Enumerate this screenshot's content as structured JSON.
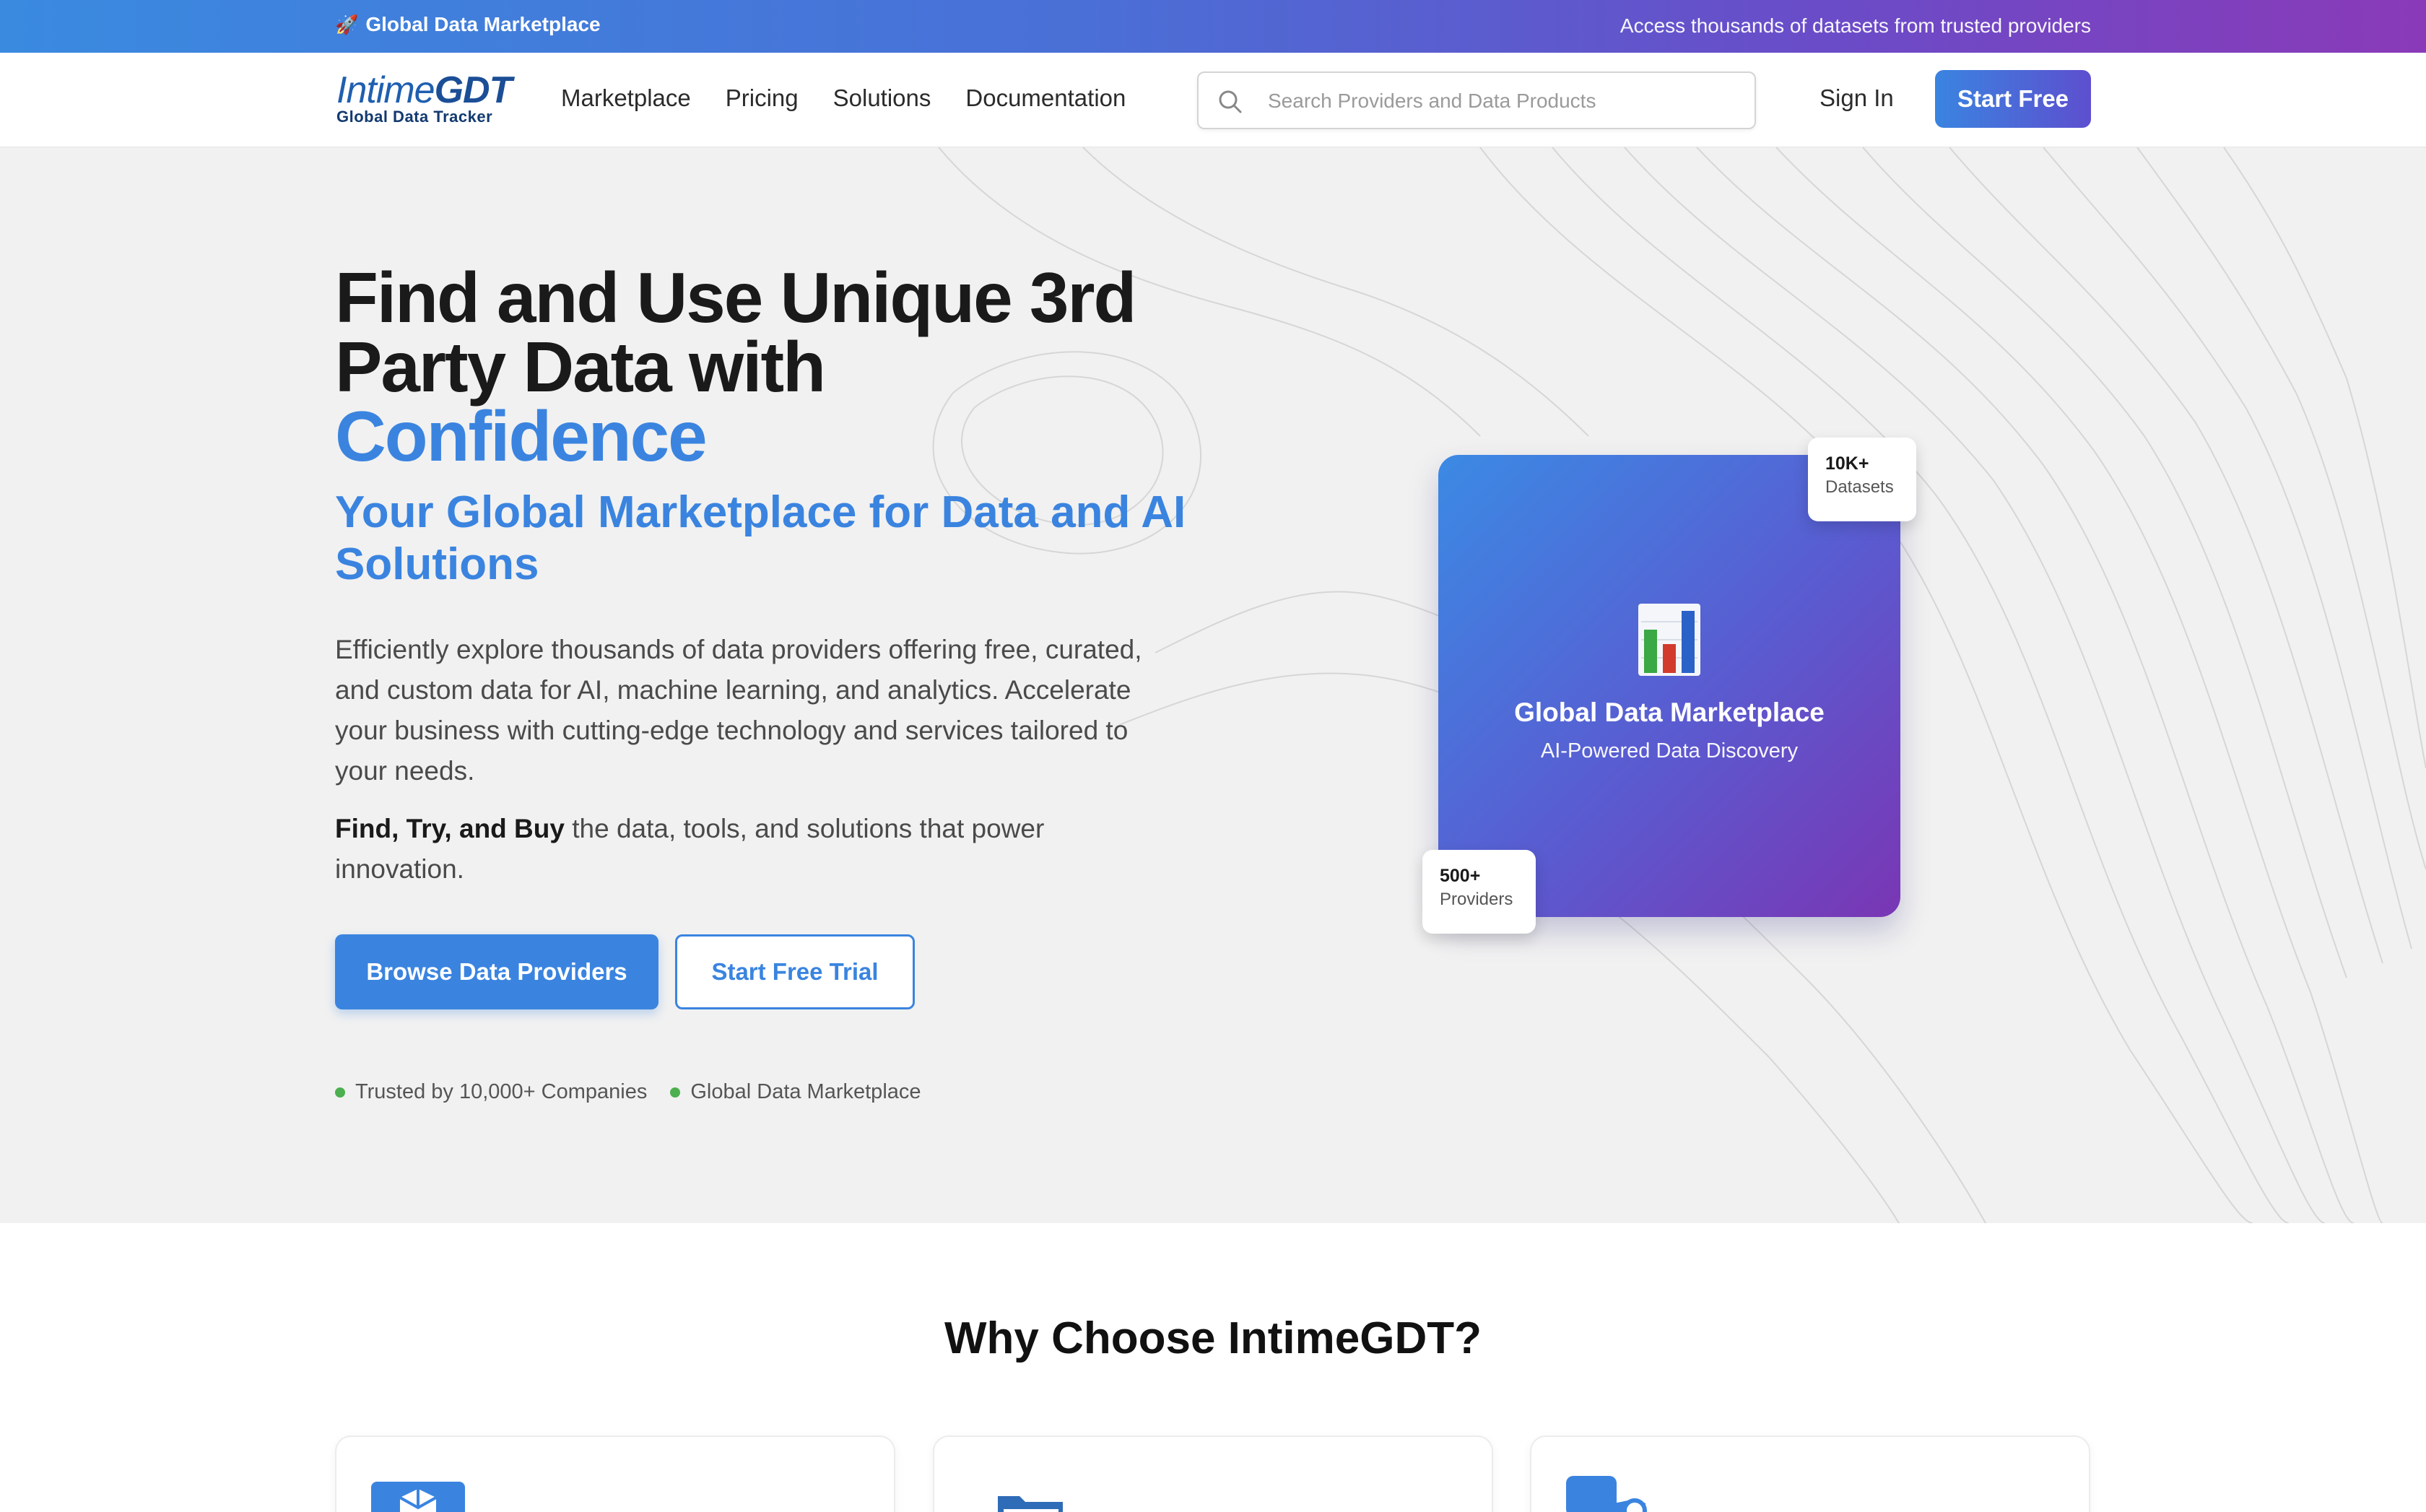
{
  "announcement": {
    "icon": "rocket-icon",
    "left_text": "Global Data Marketplace",
    "right_text": "Access thousands of datasets from trusted providers"
  },
  "header": {
    "logo_main": "Intime",
    "logo_accent": "GDT",
    "logo_tagline": "Global Data Tracker",
    "nav": [
      "Marketplace",
      "Pricing",
      "Solutions",
      "Documentation"
    ],
    "search_placeholder": "Search Providers and Data Products",
    "search_value": "",
    "sign_in": "Sign In",
    "start_free": "Start Free"
  },
  "hero": {
    "title_line1": "Find and Use Unique 3rd Party Data with",
    "title_accent": "Confidence",
    "subtitle": "Your Global Marketplace for Data and AI Solutions",
    "description": "Efficiently explore thousands of data providers offering free, curated, and custom data for AI, machine learning, and analytics. Accelerate your business with cutting-edge technology and services tailored to your needs.",
    "tagline_bold": "Find, Try, and Buy",
    "tagline_rest": " the data, tools, and solutions that power innovation.",
    "primary_button": "Browse Data Providers",
    "secondary_button": "Start Free Trial",
    "trust_items": [
      "Trusted by 10,000+ Companies",
      "Global Data Marketplace"
    ],
    "card": {
      "icon": "bar-chart-icon",
      "title": "Global Data Marketplace",
      "subtitle": "AI-Powered Data Discovery"
    },
    "stats": [
      {
        "value": "10K+",
        "label": "Datasets"
      },
      {
        "value": "500+",
        "label": "Providers"
      }
    ]
  },
  "why": {
    "heading": "Why Choose IntimeGDT?",
    "features": [
      {
        "icon": "cube-icon"
      },
      {
        "icon": "folders-icon"
      },
      {
        "icon": "connect-icon"
      }
    ]
  },
  "colors": {
    "accent": "#3a84e0",
    "gradient_start": "#3a8ae0",
    "gradient_end": "#8a3ab8",
    "status_dot": "#4caf50"
  }
}
